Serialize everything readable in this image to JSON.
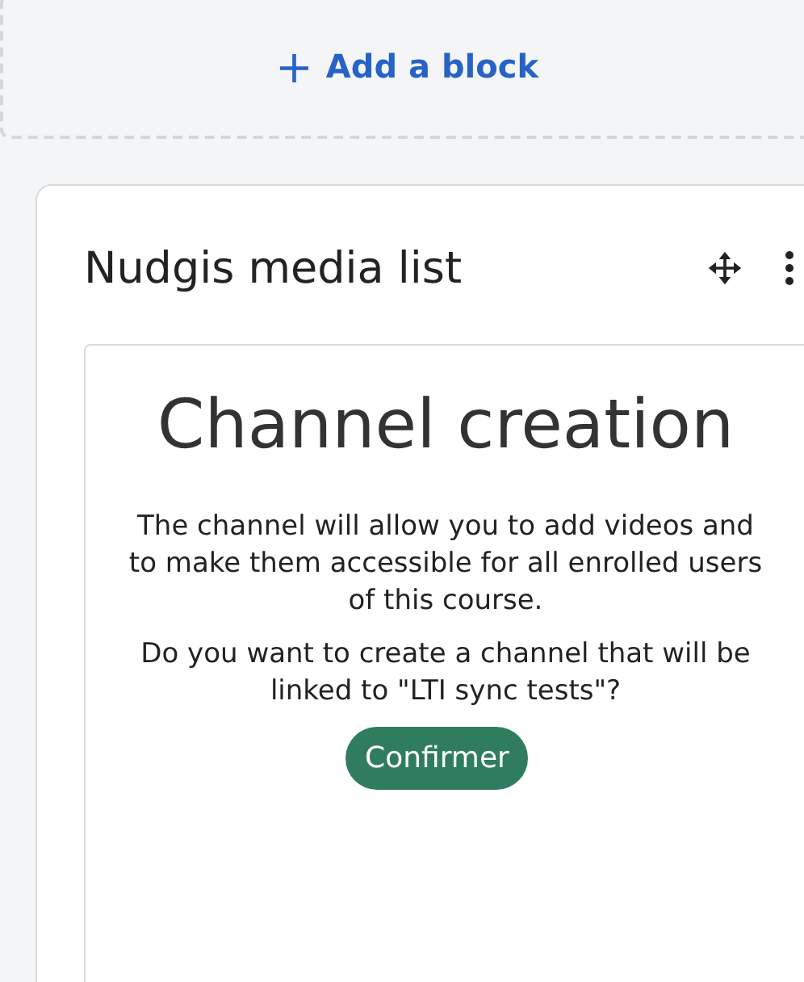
{
  "add_block": {
    "icon": "+",
    "label": "Add a block"
  },
  "block": {
    "title": "Nudgis media list",
    "content": {
      "heading": "Channel creation",
      "paragraphs": [
        "The channel will allow you to add videos and to make them accessible for all enrolled users of this course.",
        "Do you want to create a channel that will be linked to \"LTI sync tests\"?"
      ],
      "button": "Confirmer"
    }
  }
}
